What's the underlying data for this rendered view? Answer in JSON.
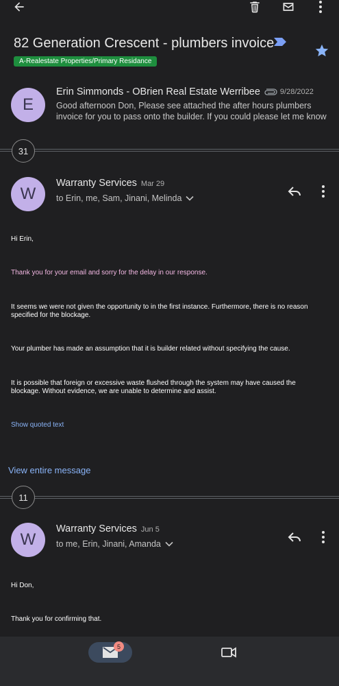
{
  "subject": {
    "title": "82 Generation Crescent - plumbers invoice",
    "label": "A-Realestate Properties/Primary Residance"
  },
  "first_message": {
    "avatar_letter": "E",
    "sender": "Erin Simmonds - OBrien Real Estate Werribee",
    "date": "9/28/2022",
    "snippet": "Good afternoon Don, Please see attached the after hours plumbers invoice for you to pass onto the builder. If you could please let me know"
  },
  "collapsed_1": {
    "count": "31"
  },
  "message_2": {
    "avatar_letter": "W",
    "sender": "Warranty Services",
    "date": "Mar 29",
    "recipients": "to Erin, me, Sam, Jinani, Melinda",
    "greeting": "Hi Erin,",
    "para1": "Thank you for your email and sorry for the delay in our response.",
    "para2": "It seems we were not given the opportunity to in the first instance.  Furthermore, there is no reason specified for the blockage.",
    "para3": "Your plumber has made an assumption that it is builder related without specifying the cause.",
    "para4": "It is possible that foreign or excessive waste flushed through the system may have caused the blockage.  Without evidence, we are unable to determine and assist.",
    "show_quoted": "Show quoted text",
    "view_entire": "View entire message"
  },
  "collapsed_2": {
    "count": "11"
  },
  "message_3": {
    "avatar_letter": "W",
    "sender": "Warranty Services",
    "date": "Jun 5",
    "recipients": "to me, Erin, Jinani, Amanda",
    "greeting": "Hi Don,",
    "para1": "Thank you for confirming that."
  },
  "bottom_nav": {
    "mail_badge": "5"
  },
  "colors": {
    "background": "#1f1f21",
    "label_chip": "#1e8e3e",
    "avatar": "#c2b0e8",
    "link": "#8ab4f8",
    "star": "#8ab4f8",
    "pink_text": "#f4b8e4"
  }
}
